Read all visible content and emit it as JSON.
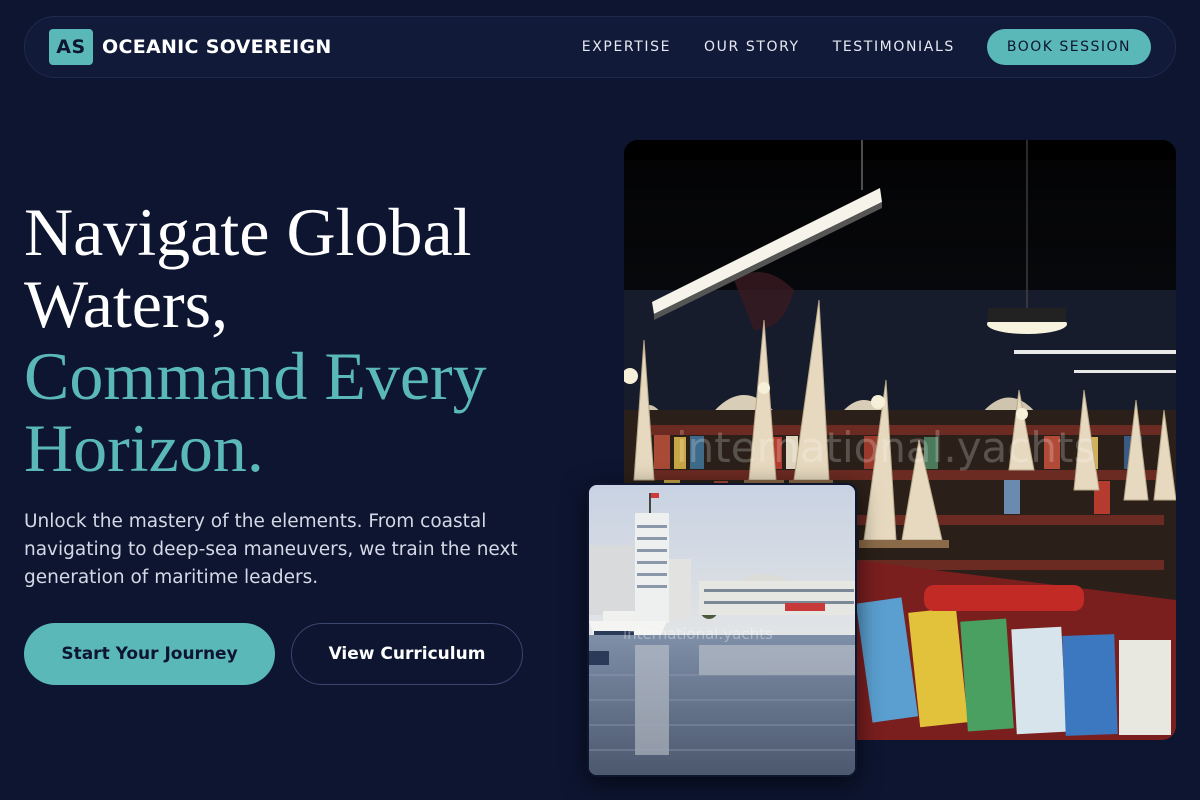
{
  "brand": {
    "badge": "AS",
    "name": "OCEANIC SOVEREIGN"
  },
  "nav": {
    "links": [
      "EXPERTISE",
      "OUR STORY",
      "TESTIMONIALS"
    ],
    "cta": "BOOK SESSION"
  },
  "hero": {
    "title_line1": "Navigate Global",
    "title_line2": "Waters,",
    "accent_line1": "Command Every",
    "accent_line2": "Horizon.",
    "subtitle": "Unlock the mastery of the elements. From coastal navigating to deep-sea maneuvers, we train the next generation of maritime leaders.",
    "primary_cta": "Start Your Journey",
    "secondary_cta": "View Curriculum"
  },
  "images": {
    "main_watermark": "international.yachts",
    "secondary_watermark": "international.yachts"
  },
  "colors": {
    "background": "#0d1530",
    "accent": "#5ab8b8",
    "nav_bg": "#111a38"
  }
}
